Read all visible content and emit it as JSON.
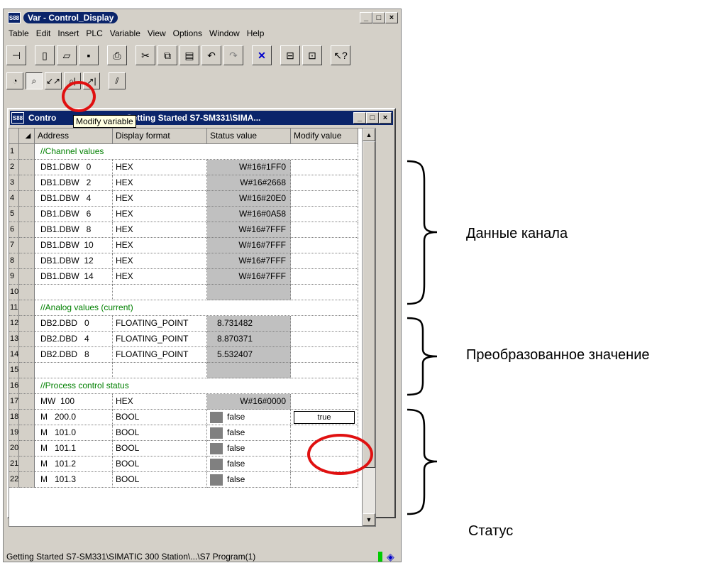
{
  "window": {
    "title": "Var - Control_Display"
  },
  "menu": [
    "Table",
    "Edit",
    "Insert",
    "PLC",
    "Variable",
    "View",
    "Options",
    "Window",
    "Help"
  ],
  "tooltip": "Modify variable",
  "child": {
    "title_pre": "Contro",
    "title_post": "Getting Started S7-SM331\\SIMA..."
  },
  "columns": {
    "address": "Address",
    "format": "Display format",
    "status": "Status value",
    "modify": "Modify value"
  },
  "rows": [
    {
      "num": "1",
      "comment": "//Channel values"
    },
    {
      "num": "2",
      "address": "DB1.DBW   0",
      "format": "HEX",
      "status": "W#16#1FF0",
      "type": "hex"
    },
    {
      "num": "3",
      "address": "DB1.DBW   2",
      "format": "HEX",
      "status": "W#16#2668",
      "type": "hex"
    },
    {
      "num": "4",
      "address": "DB1.DBW   4",
      "format": "HEX",
      "status": "W#16#20E0",
      "type": "hex"
    },
    {
      "num": "5",
      "address": "DB1.DBW   6",
      "format": "HEX",
      "status": "W#16#0A58",
      "type": "hex"
    },
    {
      "num": "6",
      "address": "DB1.DBW   8",
      "format": "HEX",
      "status": "W#16#7FFF",
      "type": "hex"
    },
    {
      "num": "7",
      "address": "DB1.DBW  10",
      "format": "HEX",
      "status": "W#16#7FFF",
      "type": "hex"
    },
    {
      "num": "8",
      "address": "DB1.DBW  12",
      "format": "HEX",
      "status": "W#16#7FFF",
      "type": "hex"
    },
    {
      "num": "9",
      "address": "DB1.DBW  14",
      "format": "HEX",
      "status": "W#16#7FFF",
      "type": "hex"
    },
    {
      "num": "10",
      "type": "empty"
    },
    {
      "num": "11",
      "comment": "//Analog values (current)"
    },
    {
      "num": "12",
      "address": "DB2.DBD   0",
      "format": "FLOATING_POINT",
      "status": "8.731482",
      "type": "float"
    },
    {
      "num": "13",
      "address": "DB2.DBD   4",
      "format": "FLOATING_POINT",
      "status": "8.870371",
      "type": "float"
    },
    {
      "num": "14",
      "address": "DB2.DBD   8",
      "format": "FLOATING_POINT",
      "status": "5.532407",
      "type": "float"
    },
    {
      "num": "15",
      "type": "empty"
    },
    {
      "num": "16",
      "comment": "//Process control status"
    },
    {
      "num": "17",
      "address": "MW  100",
      "format": "HEX",
      "status": "W#16#0000",
      "type": "hex"
    },
    {
      "num": "18",
      "address": "M   200.0",
      "format": "BOOL",
      "status": "false",
      "type": "bool",
      "modify": "true"
    },
    {
      "num": "19",
      "address": "M   101.0",
      "format": "BOOL",
      "status": "false",
      "type": "bool"
    },
    {
      "num": "20",
      "address": "M   101.1",
      "format": "BOOL",
      "status": "false",
      "type": "bool"
    },
    {
      "num": "21",
      "address": "M   101.2",
      "format": "BOOL",
      "status": "false",
      "type": "bool"
    },
    {
      "num": "22",
      "address": "M   101.3",
      "format": "BOOL",
      "status": "false",
      "type": "bool"
    }
  ],
  "status_bar": "Getting Started S7-SM331\\SIMATIC 300 Station\\...\\S7 Program(1)",
  "annotations": {
    "channel_data": "Данные канала",
    "converted_value": "Преобразованное значение",
    "status": "Статус"
  },
  "colors": {
    "highlight_circle": "#e01010",
    "title_bar": "#0a246a",
    "comment_text": "#008000"
  },
  "icons": [
    "app-icon",
    "pin-icon",
    "new-icon",
    "open-icon",
    "save-icon",
    "print-icon",
    "cut-icon",
    "copy-icon",
    "paste-icon",
    "undo-icon",
    "redo-icon",
    "delete-icon",
    "online-icon",
    "disconnect-icon",
    "help-icon",
    "monitor-icon",
    "modify-icon",
    "status-icon"
  ]
}
